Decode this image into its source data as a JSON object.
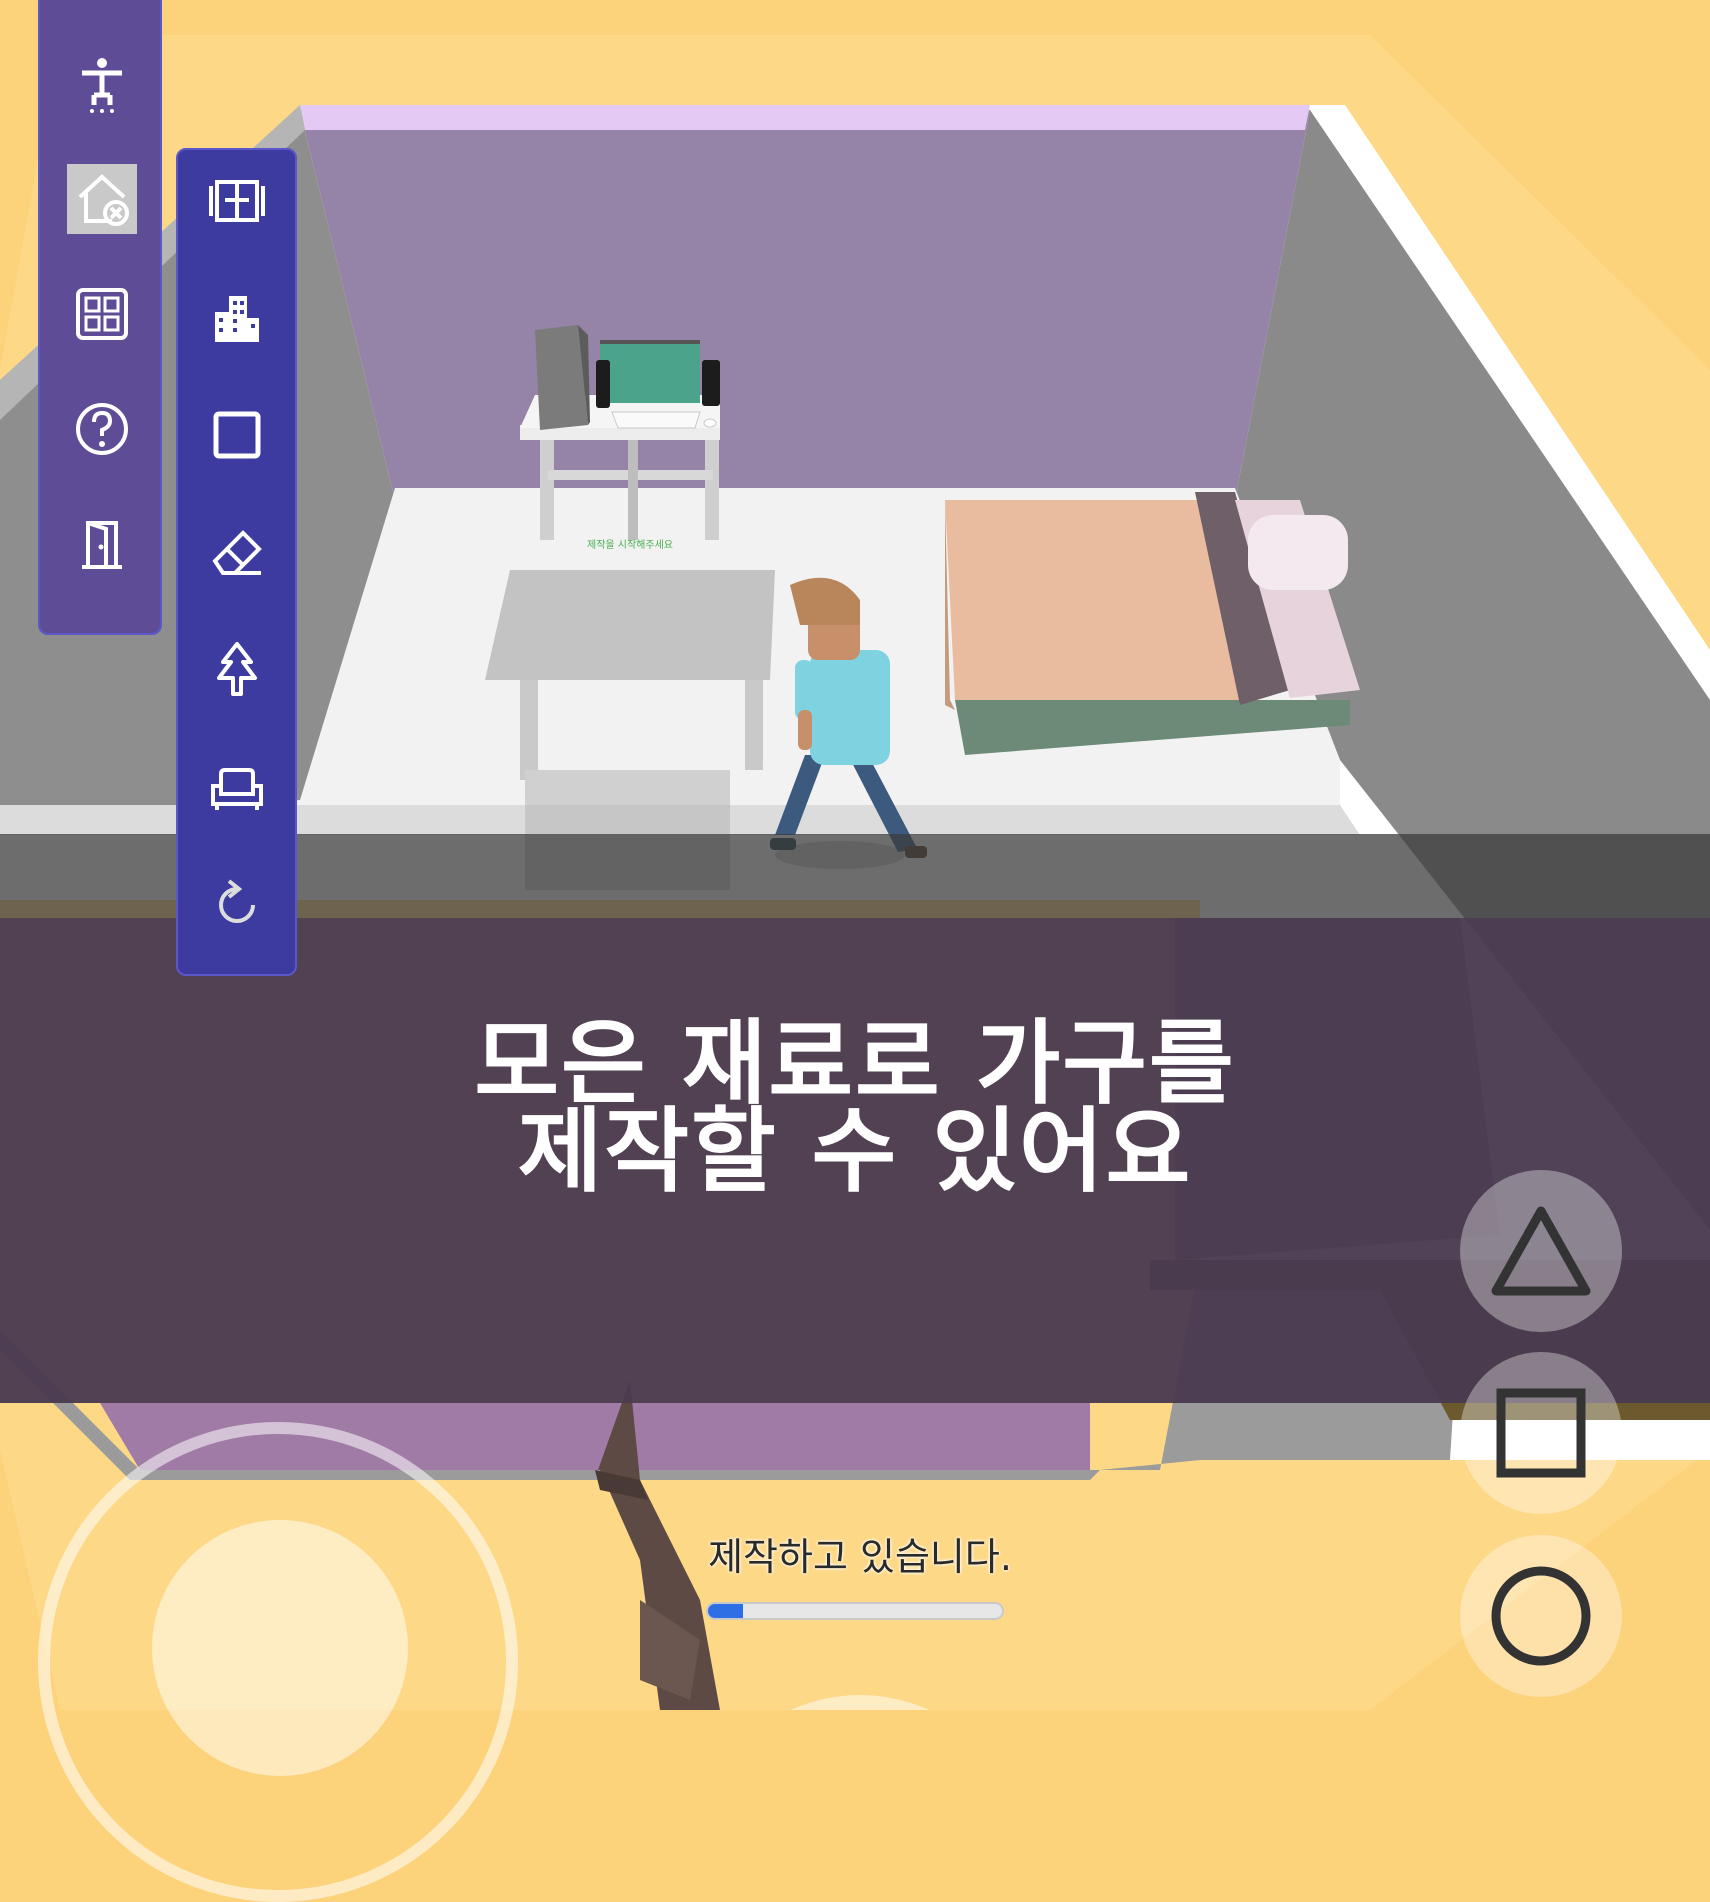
{
  "caption": {
    "line1": "모은 재료로 가구를",
    "line2": "제작할 수 있어요"
  },
  "crafting": {
    "status_text": "제작하고 있습니다.",
    "progress_fraction": 0.12
  },
  "floor_note": "제작을 시작해주세요",
  "toolbar_left": {
    "icons": [
      "character-icon",
      "house-remove-icon",
      "grid-icon",
      "help-icon",
      "exit-door-icon"
    ]
  },
  "toolbar_right": {
    "icons": [
      "window-icon",
      "building-icon",
      "square-icon",
      "eraser-icon",
      "tree-icon",
      "sofa-icon",
      "rotate-icon"
    ]
  },
  "action_buttons": [
    "triangle-button",
    "square-button",
    "circle-button"
  ],
  "colors": {
    "background": "#fcd27a",
    "toolbar": "#3d3aa0",
    "caption_band": "#4a3a50",
    "progress": "#2f6fe6"
  }
}
